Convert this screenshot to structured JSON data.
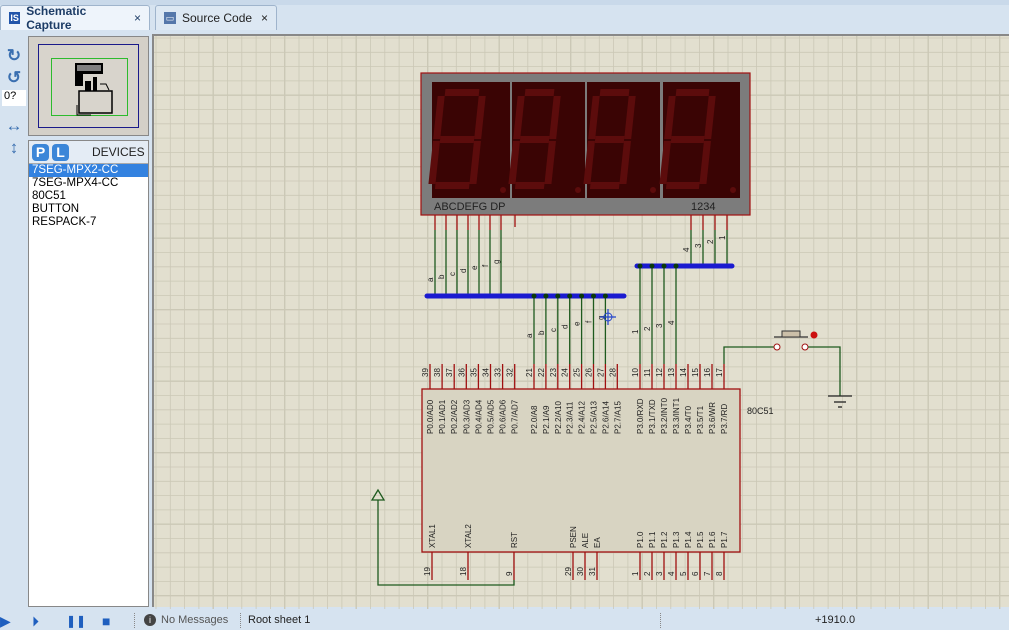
{
  "tabs": [
    {
      "label": "Schematic Capture",
      "close": "×",
      "icon": "schematic-icon"
    },
    {
      "label": "Source Code",
      "close": "×",
      "icon": "source-code-icon"
    }
  ],
  "toolbar": {
    "rotate_cw": "↻",
    "rotate_ccw": "↺",
    "angle_value": "0?",
    "mirror_h": "↔",
    "mirror_v": "↕"
  },
  "devices": {
    "p_label": "P",
    "l_label": "L",
    "title": "DEVICES",
    "items": [
      "7SEG-MPX2-CC",
      "7SEG-MPX4-CC",
      "80C51",
      "BUTTON",
      "RESPACK-7"
    ],
    "selected": 0
  },
  "schematic": {
    "display": {
      "seg_label": "ABCDEFG  DP",
      "digit_label": "1234"
    },
    "bus1_left_labels": [
      "a",
      "b",
      "c",
      "d",
      "e",
      "f",
      "g"
    ],
    "bus1_right_labels": [
      "a",
      "b",
      "c",
      "d",
      "e",
      "f",
      "g"
    ],
    "bus2_top_labels": [
      "4",
      "3",
      "2",
      "1"
    ],
    "bus2_bottom_labels": [
      "1",
      "2",
      "3",
      "4"
    ],
    "chip": {
      "name": "80C51",
      "top_pins": [
        [
          "39",
          "P0.0/AD0"
        ],
        [
          "38",
          "P0.1/AD1"
        ],
        [
          "37",
          "P0.2/AD2"
        ],
        [
          "36",
          "P0.3/AD3"
        ],
        [
          "35",
          "P0.4/AD4"
        ],
        [
          "34",
          "P0.5/AD5"
        ],
        [
          "33",
          "P0.6/AD6"
        ],
        [
          "32",
          "P0.7/AD7"
        ],
        [
          "21",
          "P2.0/A8"
        ],
        [
          "22",
          "P2.1/A9"
        ],
        [
          "23",
          "P2.2/A10"
        ],
        [
          "24",
          "P2.3/A11"
        ],
        [
          "25",
          "P2.4/A12"
        ],
        [
          "26",
          "P2.5/A13"
        ],
        [
          "27",
          "P2.6/A14"
        ],
        [
          "28",
          "P2.7/A15"
        ],
        [
          "10",
          "P3.0/RXD"
        ],
        [
          "11",
          "P3.1/TXD"
        ],
        [
          "12",
          "P3.2/INT0"
        ],
        [
          "13",
          "P3.3/INT1"
        ],
        [
          "14",
          "P3.4/T0"
        ],
        [
          "15",
          "P3.5/T1"
        ],
        [
          "16",
          "P3.6/WR"
        ],
        [
          "17",
          "P3.7/RD"
        ]
      ],
      "bottom_pins": [
        [
          "19",
          "XTAL1"
        ],
        [
          "18",
          "XTAL2"
        ],
        [
          "9",
          "RST"
        ],
        [
          "29",
          "PSEN"
        ],
        [
          "30",
          "ALE"
        ],
        [
          "31",
          "EA"
        ],
        [
          "1",
          "P1.0"
        ],
        [
          "2",
          "P1.1"
        ],
        [
          "3",
          "P1.2"
        ],
        [
          "4",
          "P1.3"
        ],
        [
          "5",
          "P1.4"
        ],
        [
          "6",
          "P1.5"
        ],
        [
          "7",
          "P1.6"
        ],
        [
          "8",
          "P1.7"
        ]
      ]
    },
    "colors": {
      "wire": "#1e5a1e",
      "pin": "#a01010",
      "bus": "#1a1ad0",
      "grid": "#cbc8b6",
      "background": "#e2dfcf",
      "display_bg": "#3a0404"
    }
  },
  "status": {
    "play": "▶",
    "step": "⏵",
    "pause": "❚❚",
    "stop": "■",
    "messages": "No Messages",
    "sheet": "Root sheet 1",
    "coord": "+1910.0"
  }
}
